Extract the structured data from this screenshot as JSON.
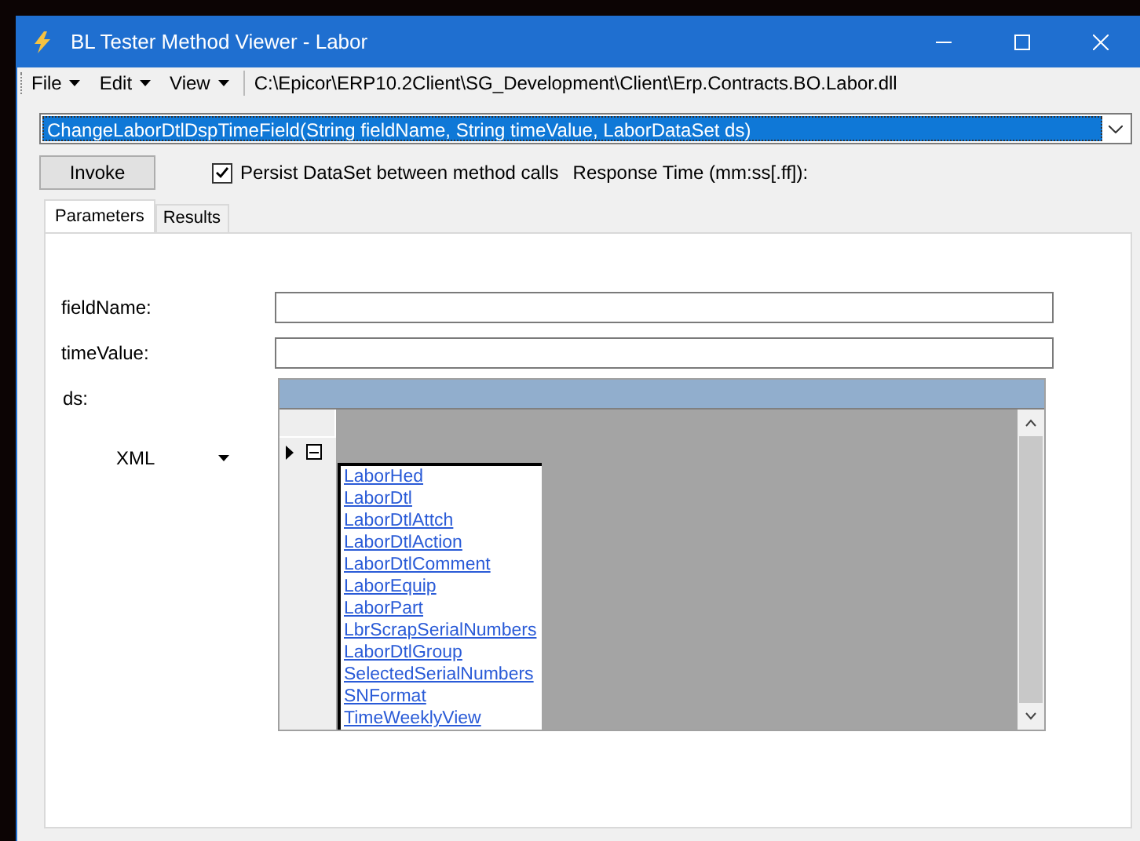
{
  "window": {
    "title": "BL Tester Method Viewer - Labor"
  },
  "menu": [
    {
      "label": "File"
    },
    {
      "label": "Edit"
    },
    {
      "label": "View"
    }
  ],
  "path": "C:\\Epicor\\ERP10.2Client\\SG_Development\\Client\\Erp.Contracts.BO.Labor.dll",
  "method": "ChangeLaborDtlDspTimeField(String fieldName, String timeValue, LaborDataSet ds)",
  "invoke": "Invoke",
  "persist": {
    "label": "Persist DataSet between method calls",
    "checked": true
  },
  "response_time": "Response Time (mm:ss[.ff]):",
  "tabs": [
    {
      "label": "Parameters",
      "selected": true
    },
    {
      "label": "Results",
      "selected": false
    }
  ],
  "params": [
    {
      "label": "fieldName:",
      "kind": "text"
    },
    {
      "label": "timeValue:",
      "kind": "text"
    },
    {
      "label": "ds:",
      "kind": "dataset",
      "format": "XML",
      "expanded": true,
      "tables": [
        "LaborHed",
        "LaborDtl",
        "LaborDtlAttch",
        "LaborDtlAction",
        "LaborDtlComment",
        "LaborEquip",
        "LaborPart",
        "LbrScrapSerialNumbers",
        "LaborDtlGroup",
        "SelectedSerialNumbers",
        "SNFormat",
        "TimeWeeklyView"
      ]
    }
  ]
}
